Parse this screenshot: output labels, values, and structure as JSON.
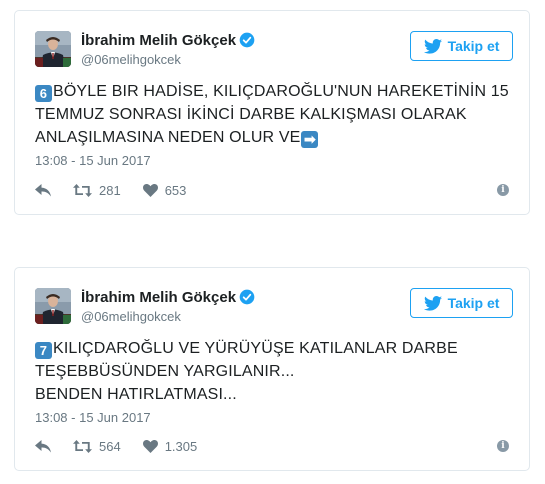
{
  "colors": {
    "accent": "#1da1f2",
    "emoji_blue": "#3b88c3",
    "muted": "#697882",
    "border": "#e1e8ed"
  },
  "tweets": [
    {
      "author": {
        "name": "İbrahim Melih Gökçek",
        "handle": "@06melihgokcek",
        "verified": true
      },
      "follow_label": "Takip et",
      "number_emoji": "6",
      "text_lines": [
        "BÖYLE BIR HADİSE, KILIÇDAROĞLU'NUN HAREKETİNİN 15",
        "TEMMUZ SONRASI İKİNCİ DARBE KALKIŞMASI OLARAK",
        "ANLAŞILMASINA NEDEN OLUR VE"
      ],
      "trailing_emoji": "➡",
      "timestamp": "13:08 - 15 Jun 2017",
      "retweets": "281",
      "likes": "653"
    },
    {
      "author": {
        "name": "İbrahim Melih Gökçek",
        "handle": "@06melihgokcek",
        "verified": true
      },
      "follow_label": "Takip et",
      "number_emoji": "7",
      "text_lines": [
        "KILIÇDAROĞLU VE YÜRÜYÜŞE KATILANLAR DARBE",
        "TEŞEBBÜSÜNDEN YARGILANIR...",
        "BENDEN HATIRLATMASI..."
      ],
      "trailing_emoji": "",
      "timestamp": "13:08 - 15 Jun 2017",
      "retweets": "564",
      "likes": "1.305"
    }
  ],
  "icons": {
    "reply": "reply-icon",
    "retweet": "retweet-icon",
    "like": "heart-icon",
    "info": "info-icon",
    "twitter": "twitter-bird-icon",
    "verified": "verified-badge-icon"
  }
}
